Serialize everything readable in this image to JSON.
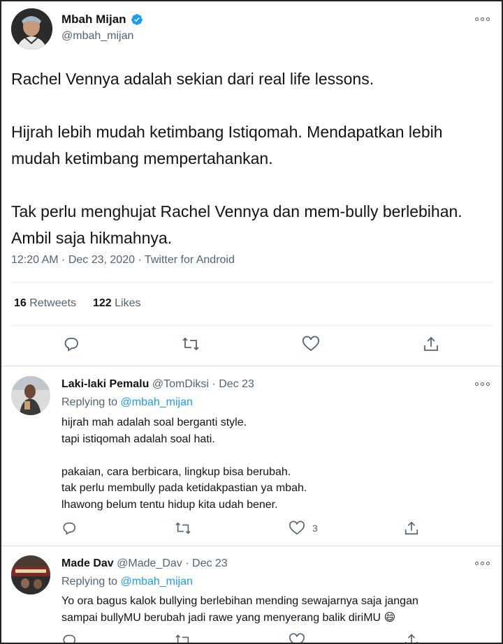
{
  "main_tweet": {
    "name": "Mbah Mijan",
    "handle": "@mbah_mijan",
    "paragraphs": [
      "Rachel Vennya adalah sekian dari real life lessons.",
      "Hijrah lebih mudah ketimbang Istiqomah. Mendapatkan lebih mudah ketimbang mempertahankan.",
      "Tak perlu menghujat Rachel Vennya dan mem-bully berlebihan. Ambil saja hikmahnya."
    ],
    "meta": "12:20 AM · Dec 23, 2020 · Twitter for Android",
    "retweets_count": "16",
    "retweets_label": "Retweets",
    "likes_count": "122",
    "likes_label": "Likes"
  },
  "replies": [
    {
      "name": "Laki-laki Pemalu",
      "handle": "@TomDiksi",
      "date": "· Dec 23",
      "replying_prefix": "Replying to",
      "replying_to": "@mbah_mijan",
      "lines": [
        "hijrah mah adalah soal berganti style.",
        "tapi istiqomah adalah soal hati.",
        "",
        "pakaian, cara berbicara, lingkup bisa berubah.",
        "tak perlu membully pada ketidakpastian ya mbah.",
        "lhawong belum tentu hidup kita udah bener."
      ],
      "like_count": "3"
    },
    {
      "name": "Made Dav",
      "handle": "@Made_Dav",
      "date": "· Dec 23",
      "replying_prefix": "Replying to",
      "replying_to": "@mbah_mijan",
      "lines": [
        "Yo ora bagus kalok bullying berlebihan mending sewajarnya saja jangan",
        "sampai bullyMU berubah jadi rawe yang menyerang balik diriMU 😄"
      ]
    }
  ],
  "colors": {
    "text": "#0f1419",
    "secondary": "#536471",
    "link": "#1d9bf0",
    "verified": "#1d9bf0"
  },
  "icons": [
    "verified-badge-icon",
    "more-options-icon",
    "reply-icon",
    "retweet-icon",
    "like-icon",
    "share-icon"
  ]
}
